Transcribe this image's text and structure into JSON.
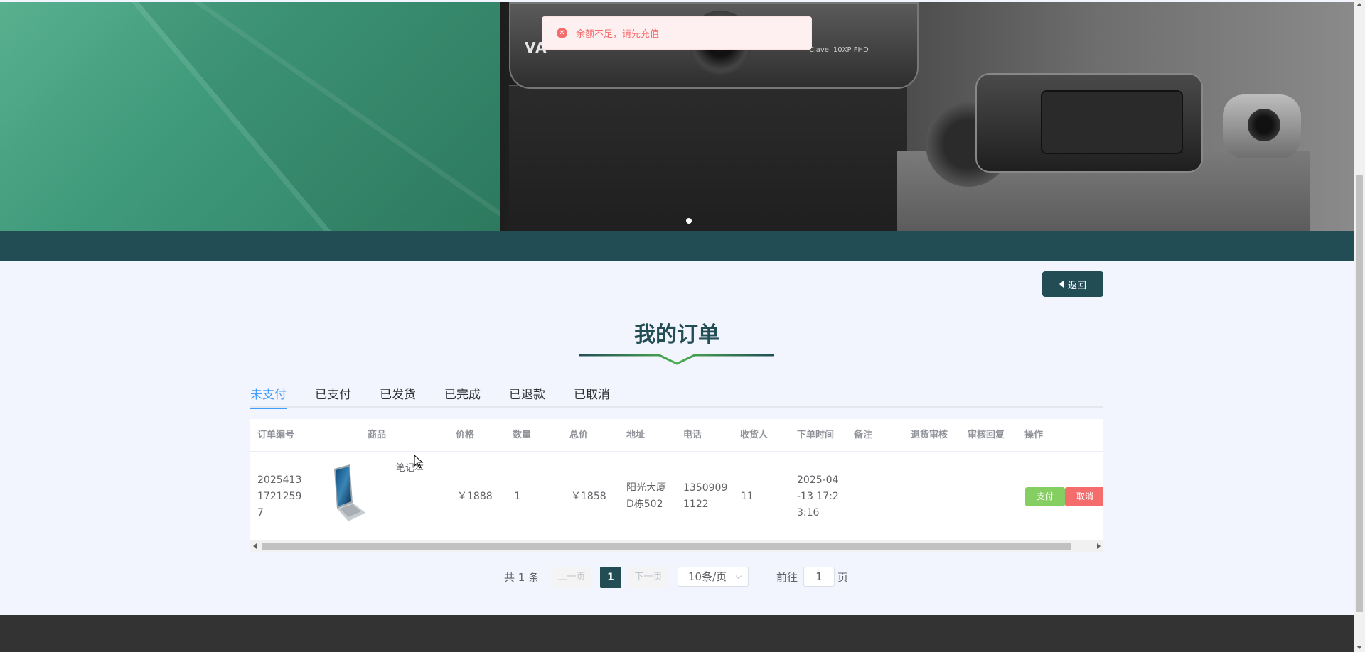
{
  "banner": {
    "brand": "VA",
    "model": "Clavel 10XP FHD",
    "active_slide": 1
  },
  "toast": {
    "type": "error",
    "icon": "error-circle-icon",
    "glyph": "✕",
    "message": "余额不足，请先充值"
  },
  "back_button": {
    "label": "返回",
    "icon": "caret-left-icon"
  },
  "page_title": "我的订单",
  "tabs": [
    {
      "label": "未支付",
      "active": true
    },
    {
      "label": "已支付",
      "active": false
    },
    {
      "label": "已发货",
      "active": false
    },
    {
      "label": "已完成",
      "active": false
    },
    {
      "label": "已退款",
      "active": false
    },
    {
      "label": "已取消",
      "active": false
    }
  ],
  "table": {
    "columns": [
      "订单编号",
      "商品",
      "价格",
      "数量",
      "总价",
      "地址",
      "电话",
      "收货人",
      "下单时间",
      "备注",
      "退货审核",
      "审核回复",
      "操作"
    ],
    "rows": [
      {
        "order_no": [
          "2025413",
          "1721259",
          "7"
        ],
        "goods_name": "笔记本",
        "goods_image": "laptop-image",
        "price": "￥1888",
        "quantity": "1",
        "total": "￥1858",
        "address": [
          "阳光大厦",
          "D栋502"
        ],
        "phone": [
          "1350909",
          "1122"
        ],
        "receiver": "11",
        "order_time": [
          "2025-04",
          "-13 17:2",
          "3:16"
        ],
        "remark": "",
        "return_review": "",
        "review_reply": "",
        "actions": {
          "pay": "支付",
          "cancel": "取消"
        }
      }
    ]
  },
  "pagination": {
    "total": "共 1 条",
    "prev": "上一页",
    "current": "1",
    "next": "下一页",
    "page_size": "10条/页",
    "goto_label": "前往",
    "goto_value": "1",
    "page_unit": "页"
  },
  "colors": {
    "primary": "#224d55",
    "tab_active": "#409eff",
    "error": "#f56c6c",
    "success": "#85ce61",
    "page_bg": "#f2f5fd",
    "footer": "#333333"
  }
}
